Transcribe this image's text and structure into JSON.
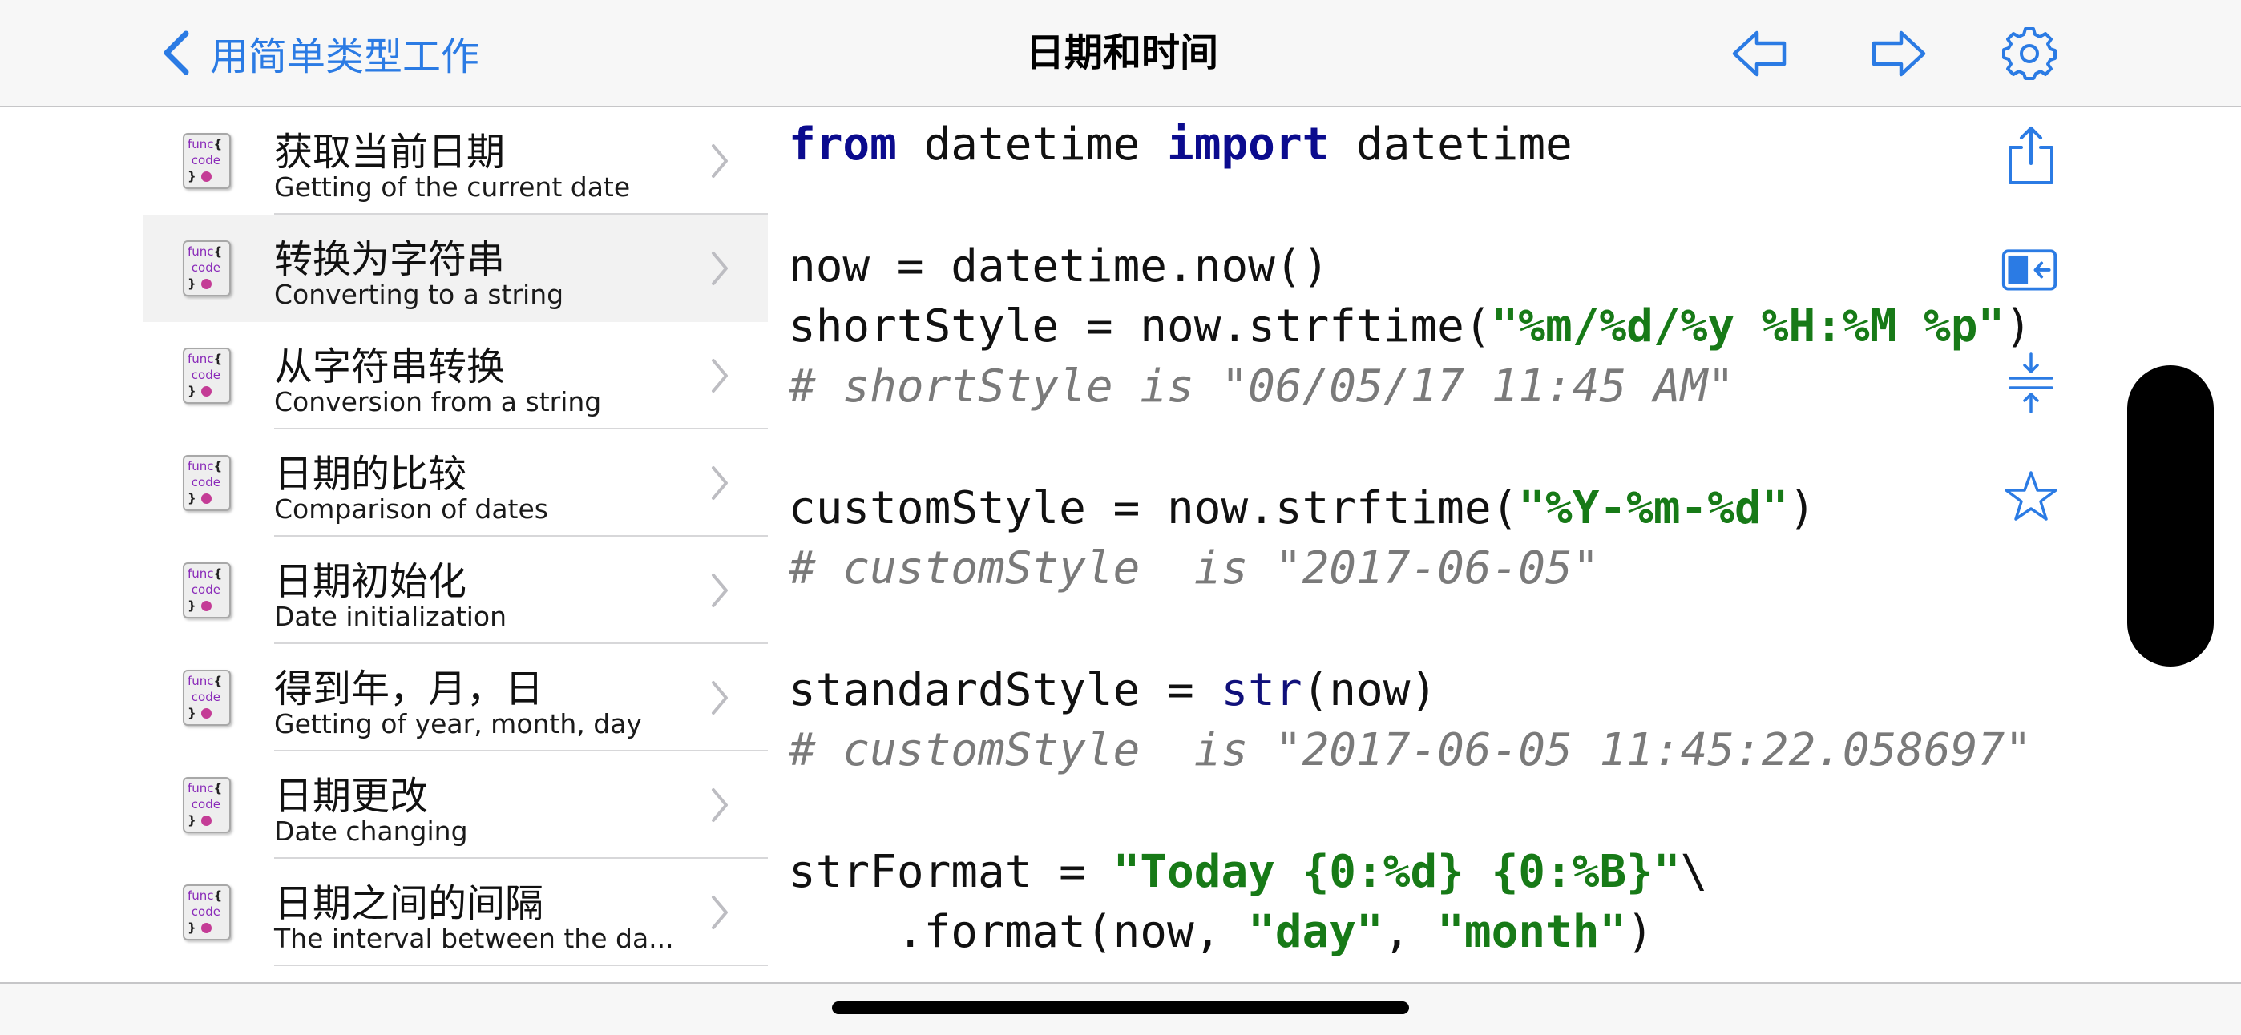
{
  "navbar": {
    "back_label": "用简单类型工作",
    "title": "日期和时间",
    "icons": [
      "arrow-left-icon",
      "arrow-right-icon",
      "gear-icon"
    ],
    "accent": "#2b7be4"
  },
  "icon_text": {
    "line1": "func",
    "line2": "code"
  },
  "list": {
    "items": [
      {
        "title": "获取当前日期",
        "subtitle": "Getting of the current date",
        "selected": false
      },
      {
        "title": "转换为字符串",
        "subtitle": "Converting to a string",
        "selected": true
      },
      {
        "title": "从字符串转换",
        "subtitle": "Conversion from a string",
        "selected": false
      },
      {
        "title": "日期的比较",
        "subtitle": "Comparison of dates",
        "selected": false
      },
      {
        "title": "日期初始化",
        "subtitle": "Date initialization",
        "selected": false
      },
      {
        "title": "得到年，月，日",
        "subtitle": "Getting of year, month, day",
        "selected": false
      },
      {
        "title": "日期更改",
        "subtitle": "Date changing",
        "selected": false
      },
      {
        "title": "日期之间的间隔",
        "subtitle": "The interval between the da...",
        "selected": false
      }
    ]
  },
  "code": {
    "l1": {
      "kw1": "from",
      "t1": " datetime ",
      "kw2": "import",
      "t2": " datetime"
    },
    "l2": {
      "t1": "now = datetime.now()"
    },
    "l3": {
      "t1": "shortStyle = now.strftime(",
      "s1": "\"%m/%d/%y %H:%M %p\"",
      "t2": ")"
    },
    "l4": {
      "c": "# shortStyle is \"06/05/17 11:45 AM\""
    },
    "l5": {
      "t1": "customStyle = now.strftime(",
      "s1": "\"%Y-%m-%d\"",
      "t2": ")"
    },
    "l6": {
      "c": "# customStyle  is \"2017-06-05\""
    },
    "l7": {
      "t1": "standardStyle = ",
      "b1": "str",
      "t2": "(now)"
    },
    "l8": {
      "c": "# customStyle  is \"2017-06-05 11:45:22.058697\""
    },
    "l9": {
      "t1": "strFormat = ",
      "s1": "\"Today {0:%d} {0:%B}\"",
      "t2": "\\"
    },
    "l10": {
      "t1": "    .format(now, ",
      "s1": "\"day\"",
      "t2": ", ",
      "s2": "\"month\"",
      "t3": ")"
    }
  },
  "side_icons": [
    "share-icon",
    "collapse-panel-icon",
    "fold-lines-icon",
    "star-icon"
  ]
}
